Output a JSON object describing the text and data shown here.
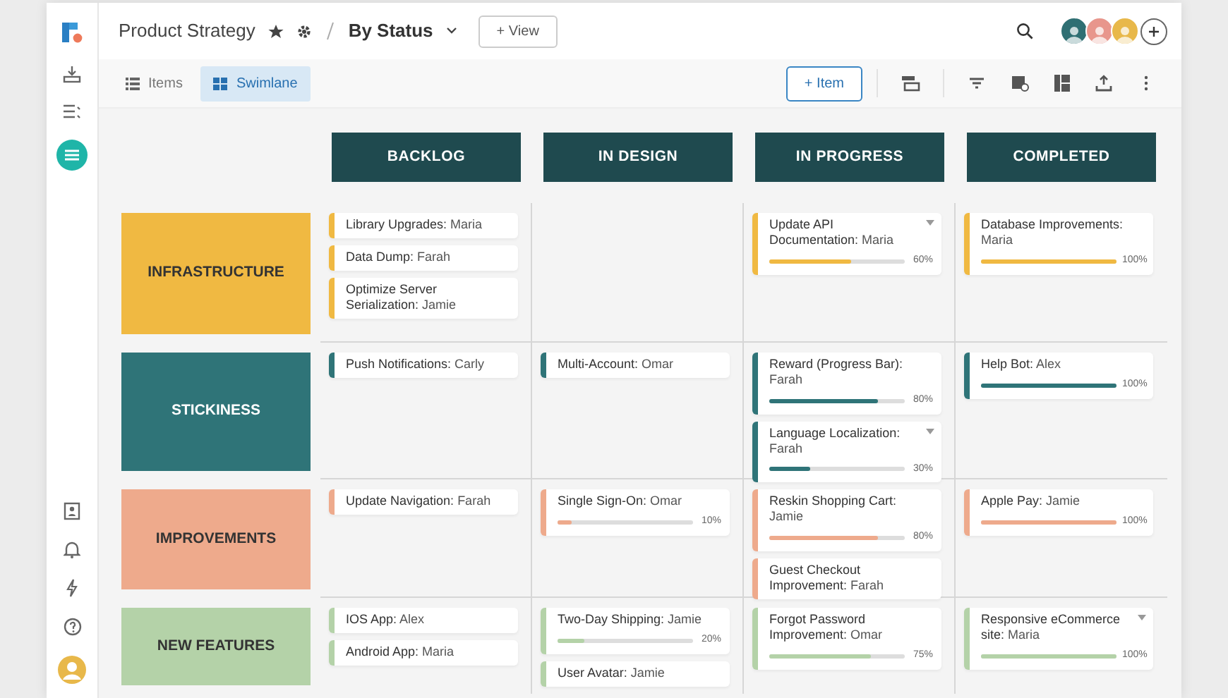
{
  "header": {
    "title": "Product Strategy",
    "view_name": "By Status",
    "add_view_button": "+ View"
  },
  "avatars": [
    {
      "color": "#2f6f73"
    },
    {
      "color": "#e8968c"
    },
    {
      "color": "#e8b84a"
    }
  ],
  "tabs": [
    {
      "label": "Items",
      "selected": false
    },
    {
      "label": "Swimlane",
      "selected": true
    }
  ],
  "add_item_button": "+ Item",
  "columns": [
    "BACKLOG",
    "IN DESIGN",
    "IN PROGRESS",
    "COMPLETED"
  ],
  "lanes": [
    {
      "label": "INFRASTRUCTURE",
      "color": "#f0b942",
      "cells": [
        [
          {
            "text": "**Library Upgrades:** Maria"
          },
          {
            "text": "**Data Dump:** Farah"
          },
          {
            "text": "**Optimize Server Serialization:** Jamie"
          }
        ],
        [],
        [
          {
            "text": "**Update API Documentation:** Maria",
            "menu": true,
            "level": 0.6,
            "reading": "60%"
          }
        ],
        [
          {
            "text": "**Database Improvements:** Maria",
            "level": 1,
            "reading": "100%"
          }
        ]
      ]
    },
    {
      "label": "STICKINESS",
      "color": "#2f7478",
      "cells": [
        [
          {
            "text": "**Push Notifications:** Carly"
          }
        ],
        [
          {
            "text": "**Multi-Account:** Omar"
          }
        ],
        [
          {
            "text": "**Reward (Progress Bar):** Farah",
            "level": 0.8,
            "reading": "80%"
          },
          {
            "text": "**Language Localization:** Farah",
            "menu": true,
            "level": 0.3,
            "reading": "30%"
          }
        ],
        [
          {
            "text": "**Help Bot:** Alex",
            "level": 1,
            "reading": "100%"
          }
        ]
      ]
    },
    {
      "label": "IMPROVEMENTS",
      "color": "#eeaa8c",
      "cells": [
        [
          {
            "text": "**Update Navigation:** Farah"
          }
        ],
        [
          {
            "text": "**Single Sign-On:** Omar",
            "level": 0.1,
            "reading": "10%"
          }
        ],
        [
          {
            "text": "**Reskin Shopping Cart:** Jamie",
            "level": 0.8,
            "reading": "80%"
          },
          {
            "text": "**Guest Checkout Improvement:** Farah"
          }
        ],
        [
          {
            "text": "**Apple Pay:** Jamie",
            "level": 1,
            "reading": "100%"
          }
        ]
      ]
    },
    {
      "label": "NEW FEATURES",
      "color": "#b4d2a8",
      "cells": [
        [
          {
            "text": "**IOS App:** Alex"
          },
          {
            "text": "**Android App:**  Maria"
          }
        ],
        [
          {
            "text": "**Two-Day Shipping:** Jamie",
            "level": 0.2,
            "reading": "20%"
          },
          {
            "text": "**User Avatar:** Jamie"
          }
        ],
        [
          {
            "text": "**Forgot Password Improvement:** Omar",
            "level": 0.75,
            "reading": "75%"
          }
        ],
        [
          {
            "text": "**Responsive eCommerce site:** Maria",
            "menu": true,
            "level": 1,
            "reading": "100%"
          }
        ]
      ]
    }
  ]
}
